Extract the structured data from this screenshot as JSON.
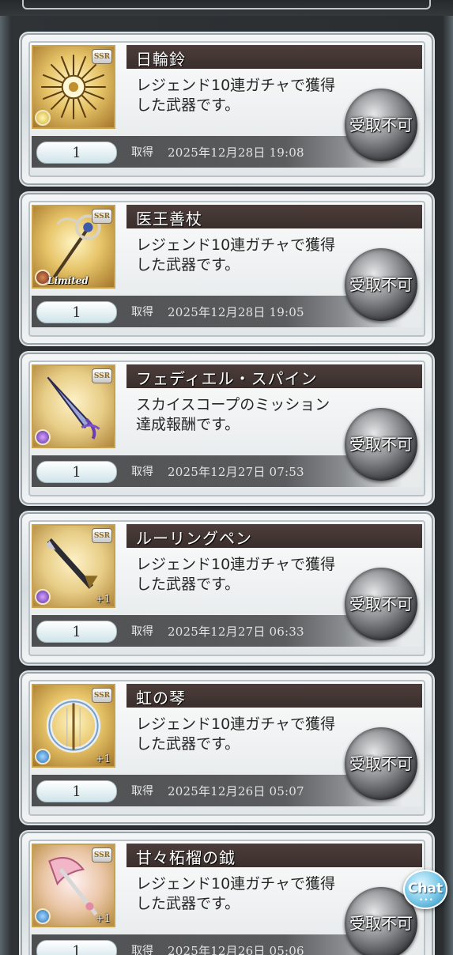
{
  "items": [
    {
      "name": "日輪鈴",
      "description": "レジェンド10連ガチャで獲得した武器です。",
      "quantity": "1",
      "acquired_label": "取得",
      "date": "2025年12月28日 19:08",
      "button_label": "受取不可",
      "rarity": "SSR",
      "element": "light",
      "tag": ""
    },
    {
      "name": "医王善杖",
      "description": "レジェンド10連ガチャで獲得した武器です。",
      "quantity": "1",
      "acquired_label": "取得",
      "date": "2025年12月28日 19:05",
      "button_label": "受取不可",
      "rarity": "SSR",
      "element": "fire",
      "tag": "Limited"
    },
    {
      "name": "フェディエル・スパイン",
      "description": "スカイスコープのミッション達成報酬です。",
      "quantity": "1",
      "acquired_label": "取得",
      "date": "2025年12月27日 07:53",
      "button_label": "受取不可",
      "rarity": "SSR",
      "element": "dark",
      "tag": ""
    },
    {
      "name": "ルーリングペン",
      "description": "レジェンド10連ガチャで獲得した武器です。",
      "quantity": "1",
      "acquired_label": "取得",
      "date": "2025年12月27日 06:33",
      "button_label": "受取不可",
      "rarity": "SSR",
      "element": "dark",
      "tag": "+1"
    },
    {
      "name": "虹の琴",
      "description": "レジェンド10連ガチャで獲得した武器です。",
      "quantity": "1",
      "acquired_label": "取得",
      "date": "2025年12月26日 05:07",
      "button_label": "受取不可",
      "rarity": "SSR",
      "element": "water",
      "tag": "+1"
    },
    {
      "name": "甘々柘榴の鉞",
      "description": "レジェンド10連ガチャで獲得した武器です。",
      "quantity": "1",
      "acquired_label": "取得",
      "date": "2025年12月26日 05:06",
      "button_label": "受取不可",
      "rarity": "SSR",
      "element": "water",
      "tag": "+1"
    }
  ],
  "chat": {
    "label": "Chat",
    "dots": "•••"
  }
}
